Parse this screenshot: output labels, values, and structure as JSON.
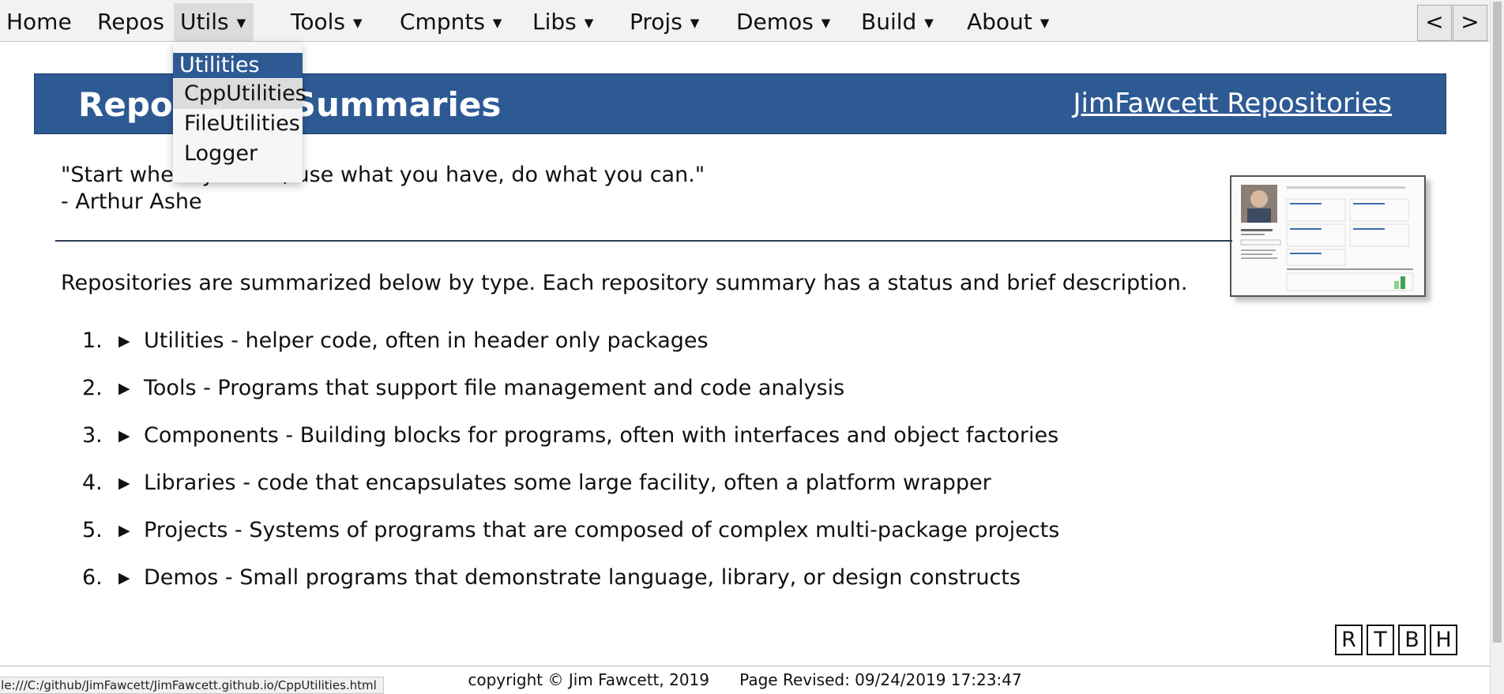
{
  "nav": {
    "items": [
      {
        "label": "Home",
        "has_menu": false
      },
      {
        "label": "Repos",
        "has_menu": false
      },
      {
        "label": "Utils",
        "has_menu": true
      },
      {
        "label": "Tools",
        "has_menu": true
      },
      {
        "label": "Cmpnts",
        "has_menu": true
      },
      {
        "label": "Libs",
        "has_menu": true
      },
      {
        "label": "Projs",
        "has_menu": true
      },
      {
        "label": "Demos",
        "has_menu": true
      },
      {
        "label": "Build",
        "has_menu": true
      },
      {
        "label": "About",
        "has_menu": true
      }
    ],
    "caret": "▼",
    "prev_label": "<",
    "next_label": ">"
  },
  "dropdown": {
    "header": "Utilities",
    "items": [
      "CppUtilities",
      "FileUtilities",
      "Logger"
    ]
  },
  "banner": {
    "title": "Repository Summaries",
    "link": "JimFawcett Repositories"
  },
  "quote": {
    "text": "\"Start where you are, use what you have, do what you can.\"",
    "author": "- Arthur Ashe"
  },
  "intro": "Repositories are summarized below by type. Each repository summary has a status and brief description.",
  "list": [
    {
      "num": "1.",
      "text": "Utilities - helper code, often in header only packages"
    },
    {
      "num": "2.",
      "text": "Tools - Programs that support file management and code analysis"
    },
    {
      "num": "3.",
      "text": "Components - Building blocks for programs, often with interfaces and object factories"
    },
    {
      "num": "4.",
      "text": "Libraries - code that encapsulates some large facility, often a platform wrapper"
    },
    {
      "num": "5.",
      "text": "Projects - Systems of programs that are composed of complex multi-package projects"
    },
    {
      "num": "6.",
      "text": "Demos - Small programs that demonstrate language, library, or design constructs"
    }
  ],
  "expand_icon": "▶",
  "nav_buttons": [
    "R",
    "T",
    "B",
    "H"
  ],
  "footer": {
    "copyright": "copyright © Jim Fawcett, 2019",
    "revised": "Page Revised: 09/24/2019 17:23:47"
  },
  "status_url": "ile:///C:/github/JimFawcett/JimFawcett.github.io/CppUtilities.html",
  "colors": {
    "banner": "#2e5a94",
    "dropdown_header": "#2e5a94",
    "nav_bg": "#f2f2f2"
  }
}
